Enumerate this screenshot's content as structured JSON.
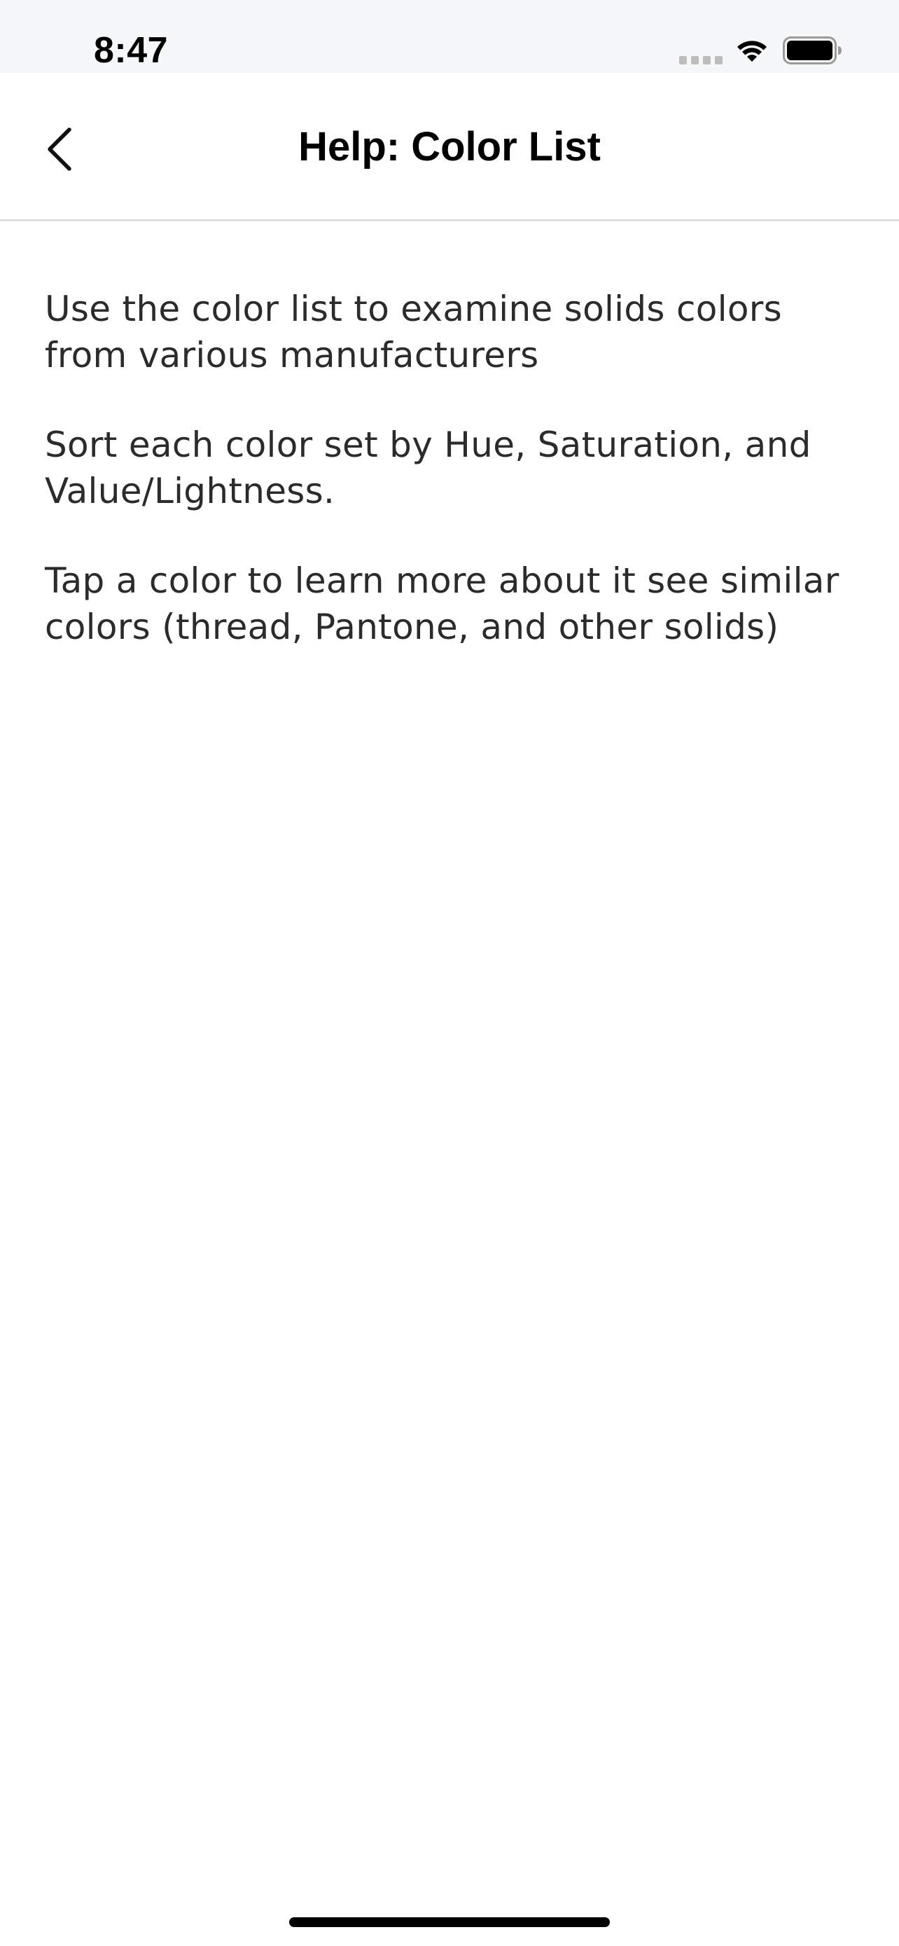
{
  "status_bar": {
    "time": "8:47",
    "icons": [
      "signal-icon",
      "wifi-icon",
      "battery-icon"
    ]
  },
  "nav": {
    "title": "Help: Color List",
    "back_icon": "chevron-left-icon"
  },
  "content": {
    "paragraphs": [
      "Use the color list to examine solids colors from various manufacturers",
      "Sort each color set by Hue, Saturation, and Value/Lightness.",
      "Tap a color to learn more about it see similar colors (thread, Pantone, and other solids)"
    ]
  },
  "colors": {
    "background": "#ffffff",
    "status_bar_bg": "#f6f7f8",
    "text": "#2b2b2b",
    "title": "#000000",
    "divider": "#dedede"
  }
}
